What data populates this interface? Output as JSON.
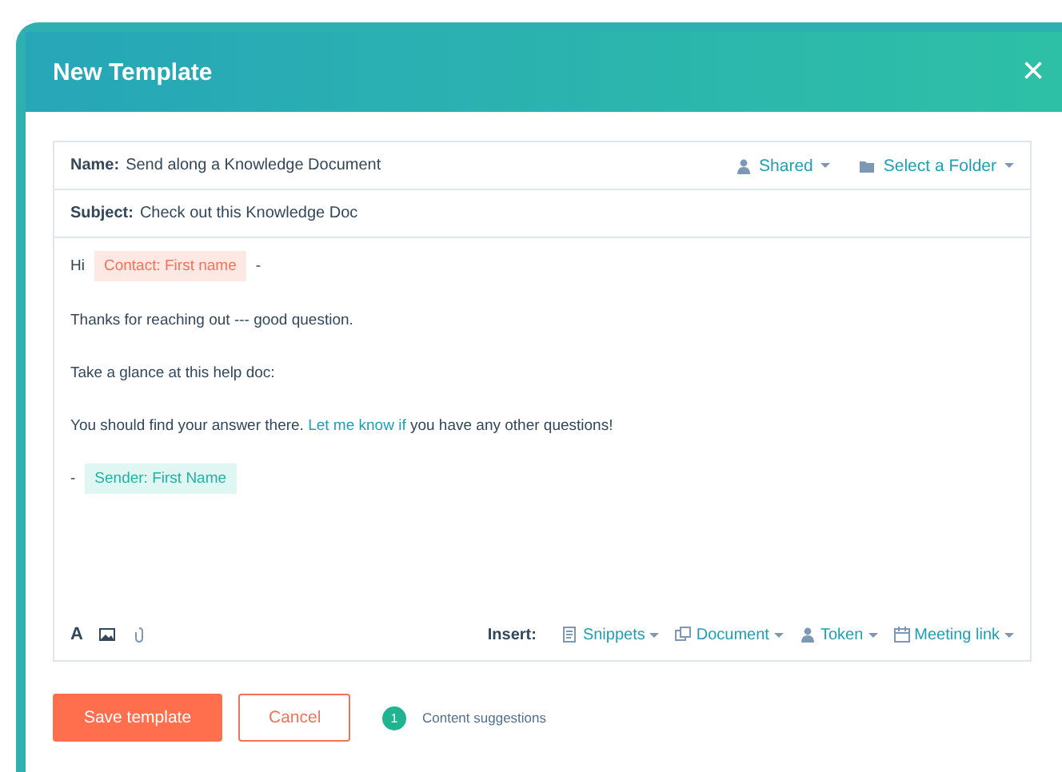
{
  "window": {
    "title": "New Template",
    "close": "×"
  },
  "name_field": {
    "label": "Name:",
    "value": "Send along a Knowledge Document"
  },
  "header_menus": [
    {
      "kind": "person",
      "label": "Shared"
    },
    {
      "kind": "folder",
      "label": "Select a Folder"
    }
  ],
  "subject_field": {
    "label": "Subject:",
    "value": "Check out this Knowledge Doc"
  },
  "body": [
    [
      {
        "kind": "text",
        "text": "Hi"
      },
      {
        "kind": "contact_token",
        "text": "Contact: First name"
      },
      {
        "kind": "text",
        "text": "-"
      }
    ],
    [
      {
        "kind": "text",
        "text": "Thanks for reaching out --- good question."
      }
    ],
    [
      {
        "kind": "text",
        "text": "Take a glance at this help doc:"
      }
    ],
    [
      {
        "kind": "text",
        "text": "You should find your answer there. "
      },
      {
        "kind": "link",
        "text": "Let me know if"
      },
      {
        "kind": "text",
        "text": " you have any other questions!"
      }
    ],
    [
      {
        "kind": "text",
        "text": "-"
      },
      {
        "kind": "sender_token",
        "text": "Sender: First Name"
      }
    ]
  ],
  "format_tools": {
    "text_style": "A"
  },
  "insert": {
    "label": "Insert:",
    "items": [
      {
        "kind": "snippet",
        "label": "Snippets"
      },
      {
        "kind": "document",
        "label": "Document"
      },
      {
        "kind": "person",
        "label": "Token"
      },
      {
        "kind": "calendar",
        "label": "Meeting link"
      }
    ]
  },
  "buttons": [
    {
      "kind": "primary",
      "label": "Save template"
    },
    {
      "kind": "secondary",
      "label": "Cancel"
    }
  ],
  "suggestions": {
    "count": "1",
    "label": "Content suggestions"
  }
}
